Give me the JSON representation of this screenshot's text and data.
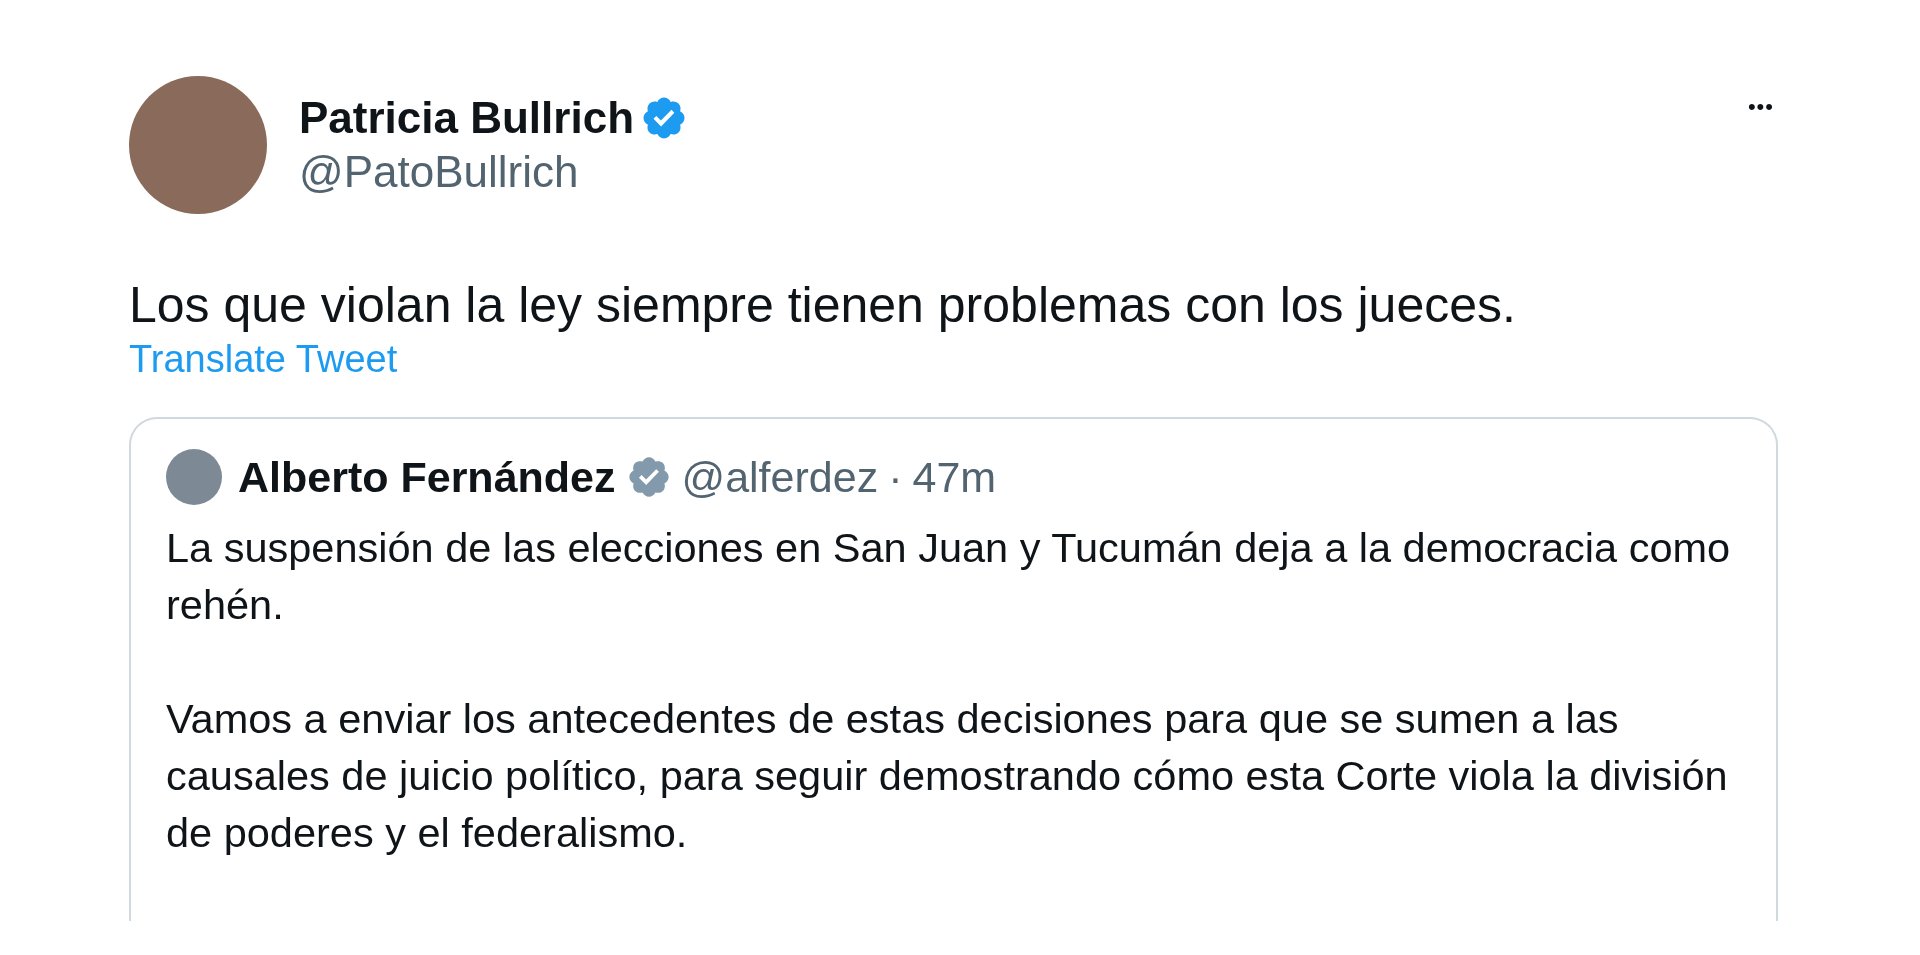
{
  "tweet": {
    "author": {
      "name": "Patricia Bullrich",
      "verified": true,
      "handle": "@PatoBullrich"
    },
    "more_button": "•••",
    "text": "Los que violan la ley siempre tienen problemas con los jueces.",
    "translate_link": "Translate Tweet",
    "quoted_tweet": {
      "author": {
        "name": "Alberto Fernández",
        "verified": true,
        "handle": "@alferdez"
      },
      "separator": "·",
      "time": "47m",
      "paragraphs": [
        "La suspensión de las elecciones en San Juan y Tucumán deja a la democracia como rehén.",
        "Vamos a enviar los antecedentes de estas decisiones para que se sumen a las causales de juicio político, para seguir demostrando cómo esta Corte viola la división de poderes y el federalismo."
      ]
    }
  }
}
